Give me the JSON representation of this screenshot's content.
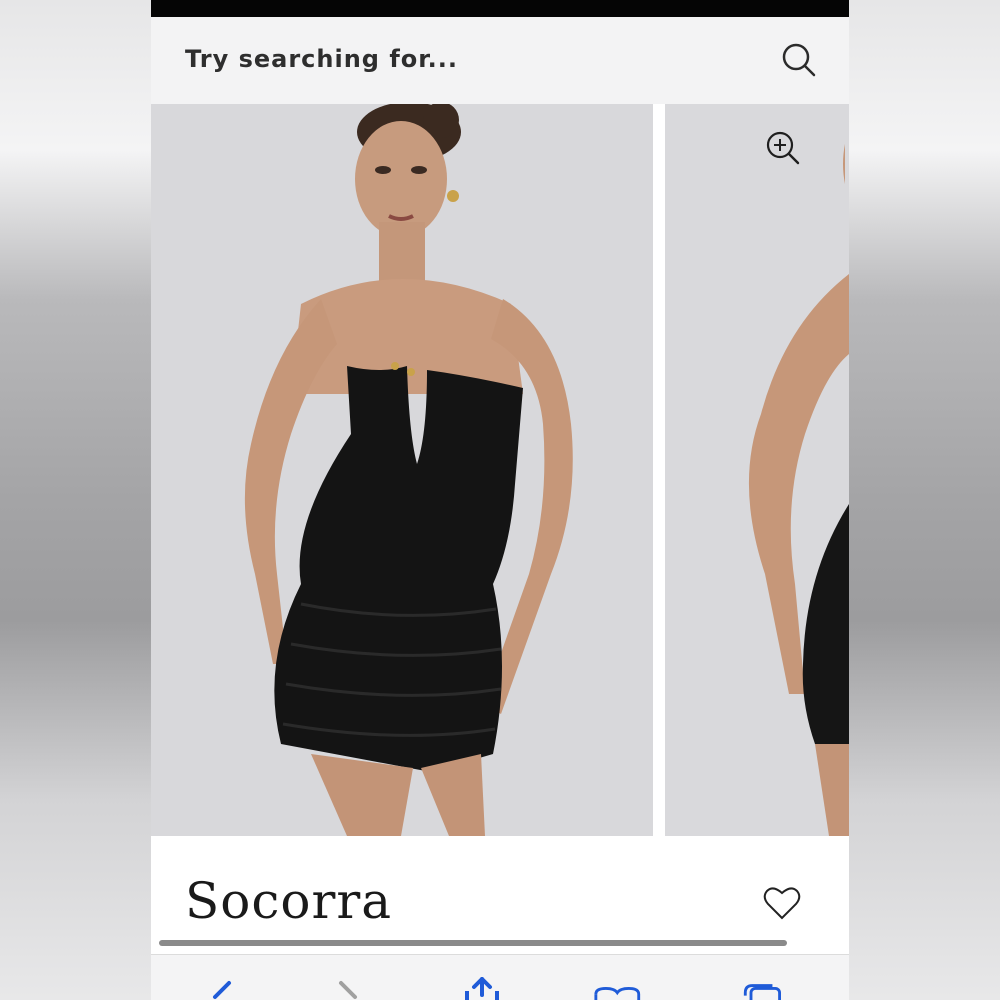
{
  "search": {
    "placeholder": "Try searching for..."
  },
  "product": {
    "name": "Socorra"
  },
  "icons": {
    "search": "search-icon",
    "zoom": "zoom-in-icon",
    "favorite": "heart-icon",
    "back": "back-arrow-icon",
    "forward": "forward-arrow-icon",
    "share": "share-icon",
    "bookmarks": "bookmarks-icon",
    "tabs": "tabs-icon"
  },
  "colors": {
    "accent": "#1f5bd8",
    "text": "#2e2e2e"
  }
}
